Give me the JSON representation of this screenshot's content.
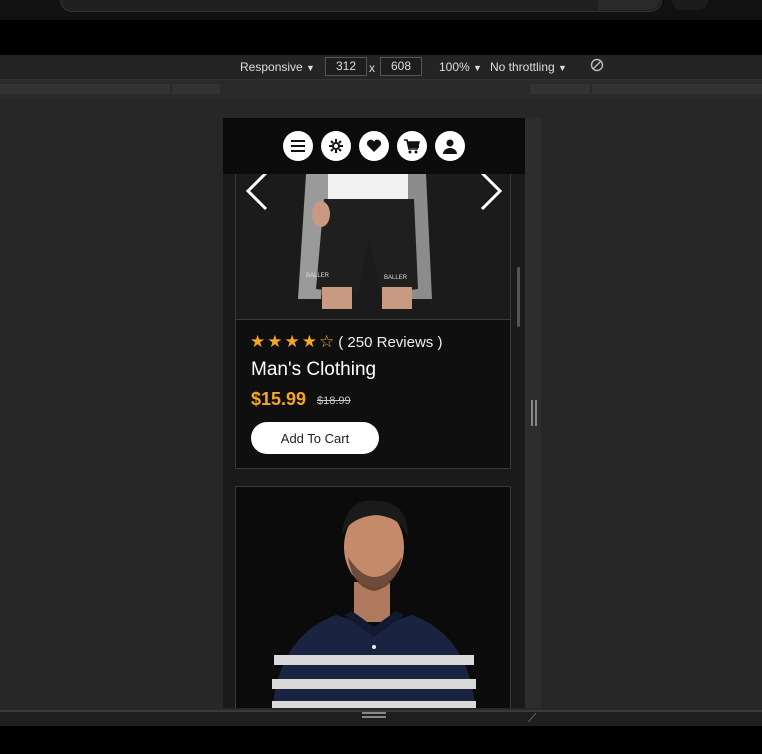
{
  "device_toolbar": {
    "device_mode": "Responsive",
    "width": "312",
    "separator": "x",
    "height": "608",
    "zoom": "100%",
    "throttling": "No throttling"
  },
  "nav": {
    "icons": [
      "menu-icon",
      "settings-icon",
      "heart-icon",
      "cart-icon",
      "user-icon"
    ]
  },
  "product": {
    "rating_stars_filled": 4,
    "rating_stars_total": 5,
    "reviews_text": "( 250 Reviews )",
    "title": "Man's Clothing",
    "price": "$15.99",
    "old_price": "$18.99",
    "add_to_cart": "Add To Cart",
    "shorts_left_text": "BALLER",
    "shorts_right_text": "BALLER"
  },
  "colors": {
    "accent": "#f5a623",
    "background": "#1a1a1a",
    "card": "#0f0f0f"
  }
}
